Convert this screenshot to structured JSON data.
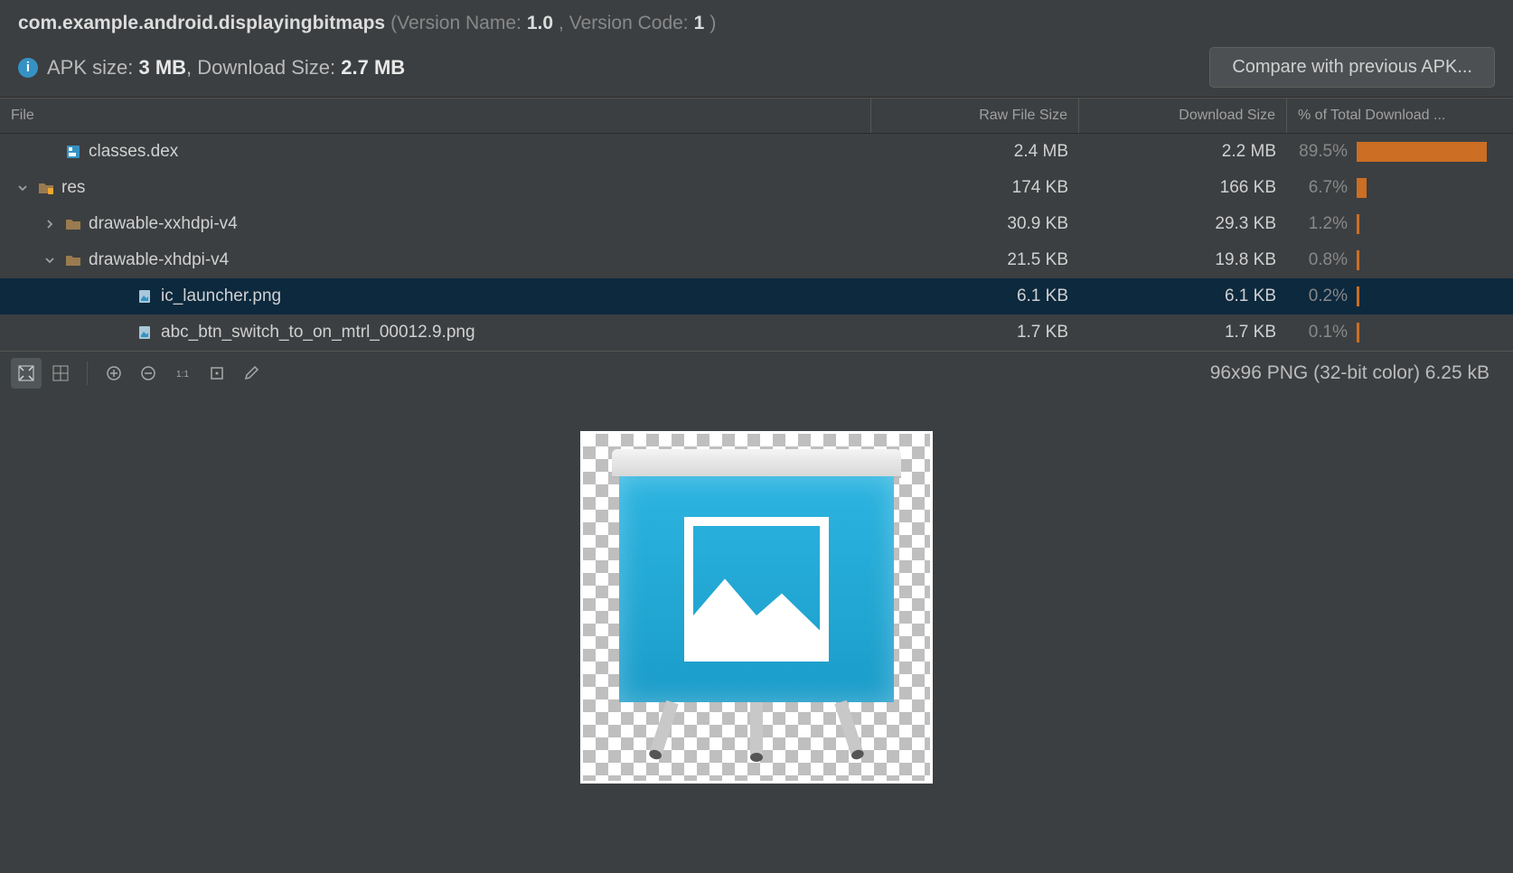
{
  "header": {
    "package": "com.example.android.displayingbitmaps",
    "versionNameLabel": "(Version Name: ",
    "versionName": "1.0",
    "versionCodeLabel": ", Version Code: ",
    "versionCode": "1",
    "closeParen": ")"
  },
  "info": {
    "apkSizeLabel": "APK size: ",
    "apkSize": "3 MB",
    "sep": ", ",
    "downloadSizeLabel": "Download Size: ",
    "downloadSize": "2.7 MB",
    "compareBtn": "Compare with previous APK..."
  },
  "columns": {
    "file": "File",
    "raw": "Raw File Size",
    "dl": "Download Size",
    "pct": "% of Total Download ..."
  },
  "rows": [
    {
      "name": "classes.dex",
      "indent": 1,
      "chevron": "",
      "icon": "dex",
      "raw": "2.4 MB",
      "dl": "2.2 MB",
      "pct": "89.5%",
      "barPct": 89.5,
      "selected": false
    },
    {
      "name": "res",
      "indent": 0,
      "chevron": "down",
      "icon": "folder-res",
      "raw": "174 KB",
      "dl": "166 KB",
      "pct": "6.7%",
      "barPct": 6.7,
      "selected": false
    },
    {
      "name": "drawable-xxhdpi-v4",
      "indent": 1,
      "chevron": "right",
      "icon": "folder",
      "raw": "30.9 KB",
      "dl": "29.3 KB",
      "pct": "1.2%",
      "barPct": 1.2,
      "selected": false
    },
    {
      "name": "drawable-xhdpi-v4",
      "indent": 1,
      "chevron": "down",
      "icon": "folder",
      "raw": "21.5 KB",
      "dl": "19.8 KB",
      "pct": "0.8%",
      "barPct": 0.8,
      "selected": false
    },
    {
      "name": "ic_launcher.png",
      "indent": 3,
      "chevron": "",
      "icon": "image",
      "raw": "6.1 KB",
      "dl": "6.1 KB",
      "pct": "0.2%",
      "barPct": 0.2,
      "selected": true
    },
    {
      "name": "abc_btn_switch_to_on_mtrl_00012.9.png",
      "indent": 3,
      "chevron": "",
      "icon": "image",
      "raw": "1.7 KB",
      "dl": "1.7 KB",
      "pct": "0.1%",
      "barPct": 0.1,
      "selected": false
    }
  ],
  "preview": {
    "info": "96x96 PNG (32-bit color) 6.25 kB"
  }
}
